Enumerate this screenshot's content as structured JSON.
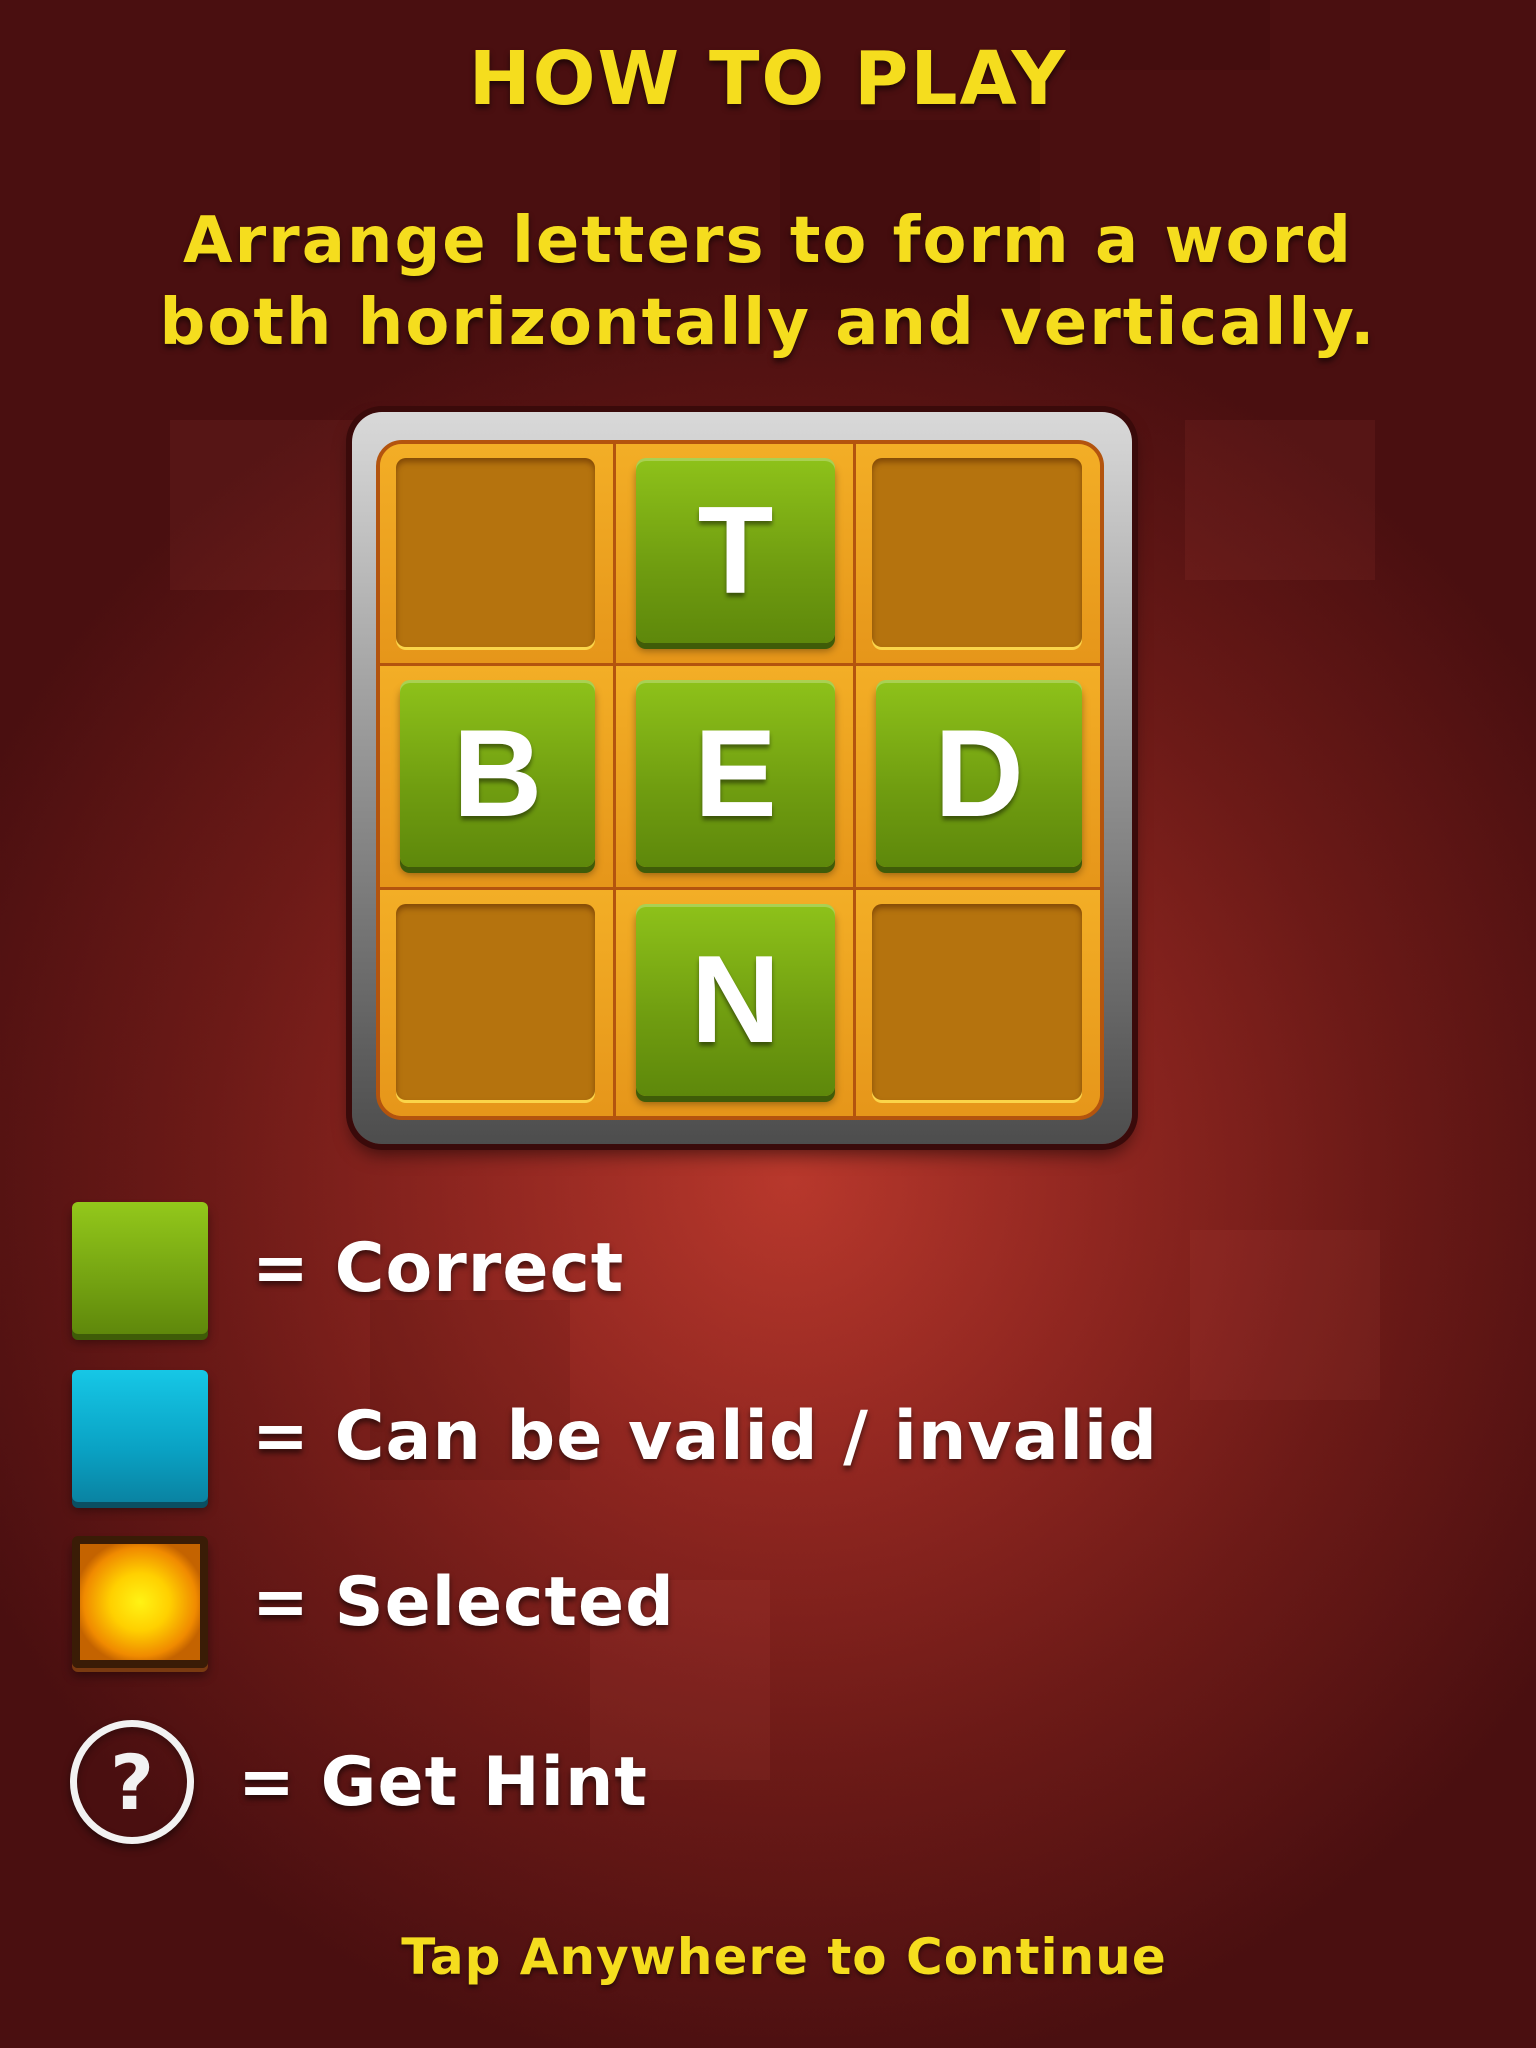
{
  "header": {
    "title": "HOW TO PLAY"
  },
  "instructions": {
    "line1": "Arrange letters to form a word",
    "line2": "both horizontally and vertically."
  },
  "board": {
    "rows": [
      [
        "",
        "T",
        ""
      ],
      [
        "B",
        "E",
        "D"
      ],
      [
        "",
        "N",
        ""
      ]
    ]
  },
  "legend": {
    "correct": {
      "label": "= Correct",
      "color": "#7db516"
    },
    "maybe": {
      "label": "= Can be valid / invalid",
      "color": "#0fb2d4"
    },
    "selected": {
      "label": "= Selected",
      "color": "#ffd000"
    },
    "hint": {
      "label": "= Get Hint",
      "symbol": "?"
    }
  },
  "footer": {
    "continue_text": "Tap Anywhere to Continue"
  },
  "colors": {
    "title_yellow": "#f5dd1e",
    "board_orange": "#e89b18",
    "tile_green": "#7db516",
    "background_red": "#8f2620"
  }
}
